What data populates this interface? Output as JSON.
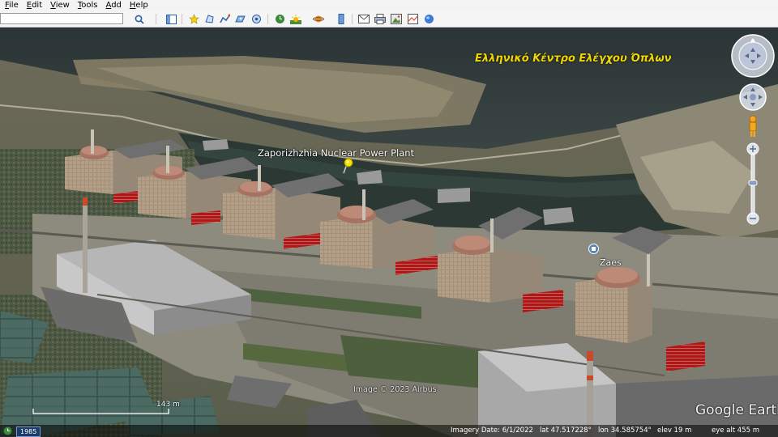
{
  "menu": {
    "file": "File",
    "edit": "Edit",
    "view": "View",
    "tools": "Tools",
    "add": "Add",
    "help": "Help"
  },
  "toolbar": {
    "search_value": "",
    "buttons": [
      "search-icon",
      "sidebar-icon",
      "placemark-icon",
      "polygon-icon",
      "path-icon",
      "image-overlay-icon",
      "tour-icon",
      "historical-imagery-icon",
      "sunlight-icon",
      "planets-icon",
      "ruler-icon",
      "email-icon",
      "print-icon",
      "save-image-icon",
      "maps-icon"
    ]
  },
  "map": {
    "title_overlay": "Ελληνικό Κέντρο Ελέγχου Όπλων",
    "placemark_label": "Zaporizhzhia Nuclear Power Plant",
    "poi_label": "Zaes",
    "image_credit": "Image © 2023 Airbus",
    "logo": "Google Earth",
    "scale_label": "143 m"
  },
  "status": {
    "historical_year": "1985",
    "imagery_date": "Imagery Date: 6/1/2022",
    "lat": "lat   47.517228°",
    "lon": "lon   34.585754°",
    "elev": "elev     19 m",
    "eye_alt": "eye alt    455 m"
  },
  "colors": {
    "title_overlay": "#f2d600",
    "placemark_pin": "#f5e400",
    "roof_red": "#b01818"
  }
}
